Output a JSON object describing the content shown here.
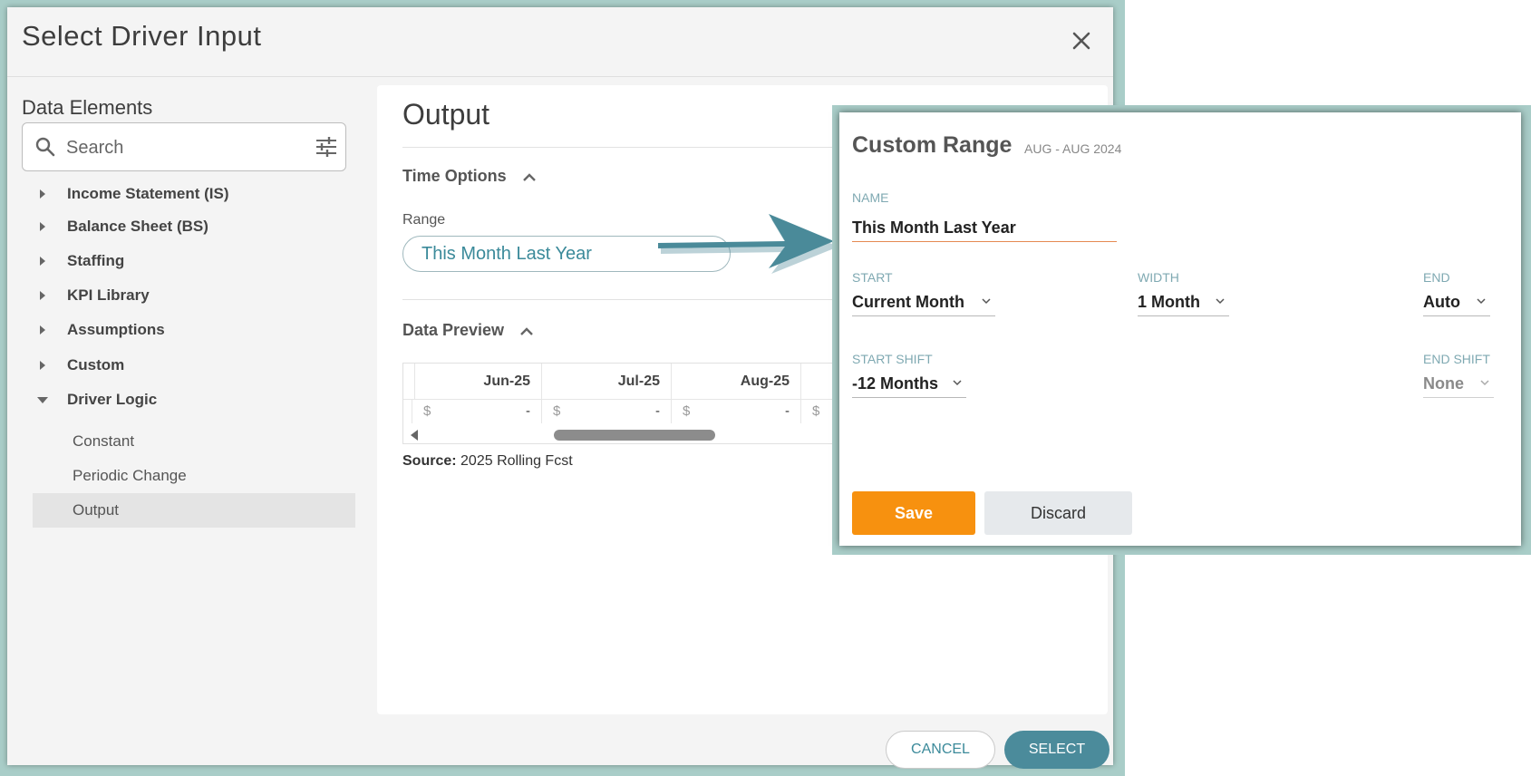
{
  "dialog": {
    "title": "Select Driver Input",
    "cancel_label": "CANCEL",
    "select_label": "SELECT"
  },
  "sidebar": {
    "title": "Data Elements",
    "search_placeholder": "Search",
    "items": [
      {
        "label": "Income Statement (IS)",
        "expanded": false
      },
      {
        "label": "Balance Sheet (BS)",
        "expanded": false
      },
      {
        "label": "Staffing",
        "expanded": false
      },
      {
        "label": "KPI Library",
        "expanded": false
      },
      {
        "label": "Assumptions",
        "expanded": false
      },
      {
        "label": "Custom",
        "expanded": false
      },
      {
        "label": "Driver Logic",
        "expanded": true
      }
    ],
    "children": [
      {
        "label": "Constant",
        "selected": false
      },
      {
        "label": "Periodic Change",
        "selected": false
      },
      {
        "label": "Output",
        "selected": true
      }
    ]
  },
  "output": {
    "title": "Output",
    "time_options_label": "Time Options",
    "range_label": "Range",
    "range_value": "This Month Last Year",
    "data_preview_label": "Data Preview",
    "columns": [
      "Jun-25",
      "Jul-25",
      "Aug-25"
    ],
    "row": [
      {
        "currency": "$",
        "value": "-"
      },
      {
        "currency": "$",
        "value": "-"
      },
      {
        "currency": "$",
        "value": "-"
      },
      {
        "currency": "$",
        "value": ""
      }
    ],
    "source_label": "Source:",
    "source_value": "2025 Rolling Fcst"
  },
  "custom_range": {
    "title": "Custom Range",
    "subtitle": "AUG - AUG 2024",
    "name_label": "NAME",
    "name_value": "This Month Last Year",
    "start_label": "START",
    "start_value": "Current Month",
    "width_label": "WIDTH",
    "width_value": "1 Month",
    "end_label": "END",
    "end_value": "Auto",
    "start_shift_label": "START SHIFT",
    "start_shift_value": "-12 Months",
    "end_shift_label": "END SHIFT",
    "end_shift_value": "None",
    "save_label": "Save",
    "discard_label": "Discard"
  },
  "colors": {
    "frame": "#a9cdc8",
    "accent_teal": "#4b8b9b",
    "save_orange": "#f7910f",
    "arrow": "#4a8a99"
  }
}
